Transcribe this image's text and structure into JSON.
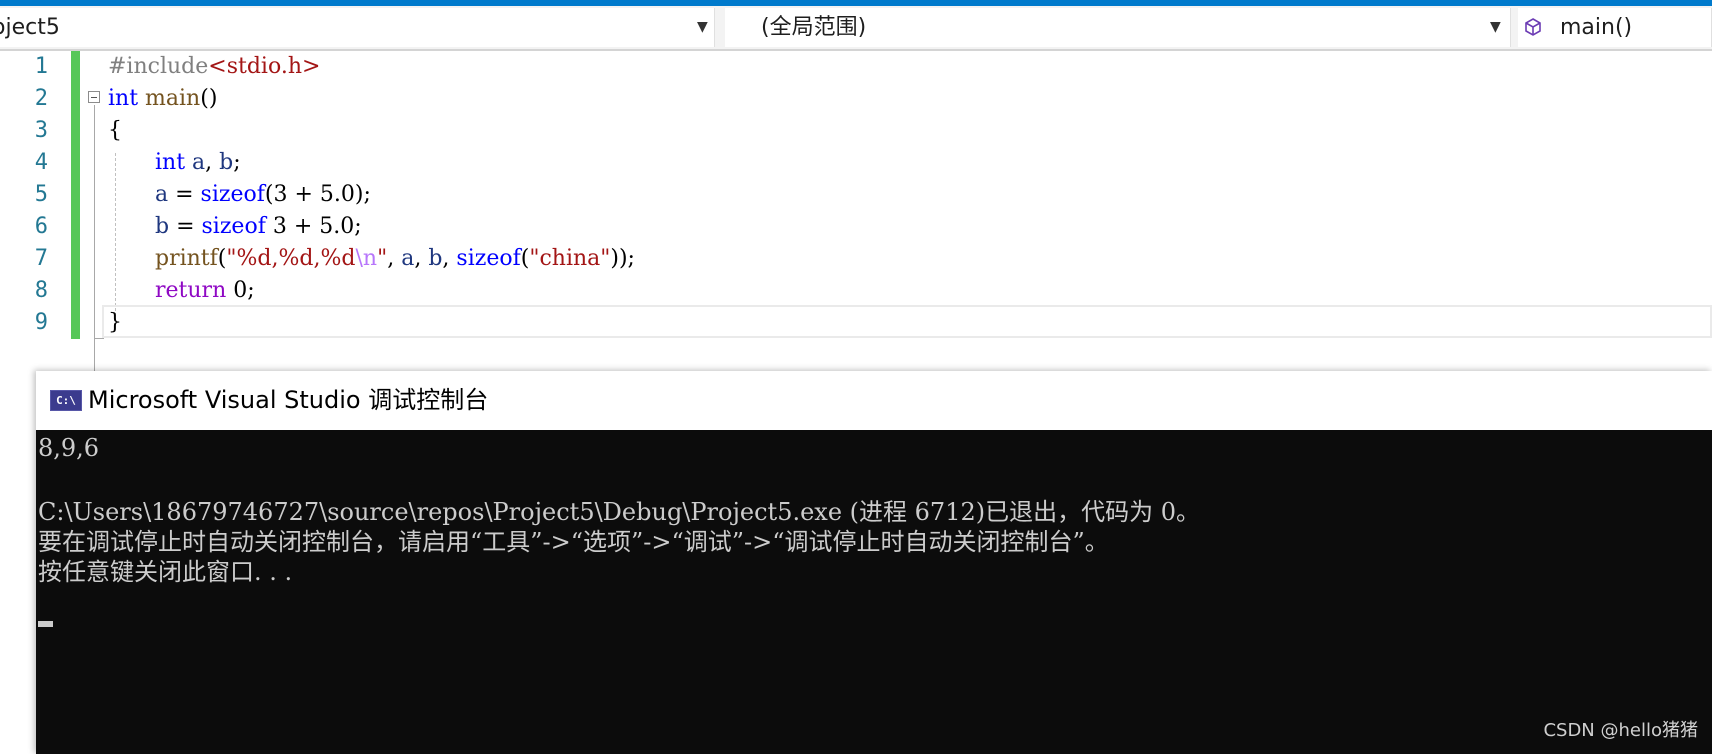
{
  "navbar": {
    "project": "oject5",
    "scope": "(全局范围)",
    "member": "main()"
  },
  "editor": {
    "line_numbers": [
      "1",
      "2",
      "3",
      "4",
      "5",
      "6",
      "7",
      "8",
      "9"
    ],
    "lines": {
      "l1_directive": "#include",
      "l1_header": "<stdio.h>",
      "l2_type": "int",
      "l2_name": " main",
      "l2_rest": "()",
      "l3": "{",
      "l4_type": "int",
      "l4_a": "a",
      "l4_sep": ", ",
      "l4_b": "b",
      "l4_end": ";",
      "l5_var": "a",
      "l5_op": " = ",
      "l5_kw": "sizeof",
      "l5_rest": "(3 + 5.0);",
      "l6_var": "b",
      "l6_op": " = ",
      "l6_kw": "sizeof",
      "l6_rest": " 3 + 5.0;",
      "l7_fn": "printf",
      "l7_open": "(",
      "l7_fmt": "\"%d,%d,%d",
      "l7_esc": "\\n",
      "l7_quote": "\"",
      "l7_sep1": ", ",
      "l7_a": "a",
      "l7_sep2": ", ",
      "l7_b": "b",
      "l7_sep3": ", ",
      "l7_kw": "sizeof",
      "l7_open2": "(",
      "l7_str": "\"china\"",
      "l7_close": "));",
      "l8_kw": "return",
      "l8_rest": " 0;",
      "l9": "}"
    }
  },
  "console": {
    "title": "Microsoft Visual Studio 调试控制台",
    "icon_text": "C:\\",
    "output": [
      "8,9,6",
      "",
      "C:\\Users\\18679746727\\source\\repos\\Project5\\Debug\\Project5.exe (进程 6712)已退出，代码为 0。",
      "要在调试停止时自动关闭控制台，请启用“工具”->“选项”->“调试”->“调试停止时自动关闭控制台”。",
      "按任意键关闭此窗口. . ."
    ]
  },
  "watermark": "CSDN @hello猪猪"
}
